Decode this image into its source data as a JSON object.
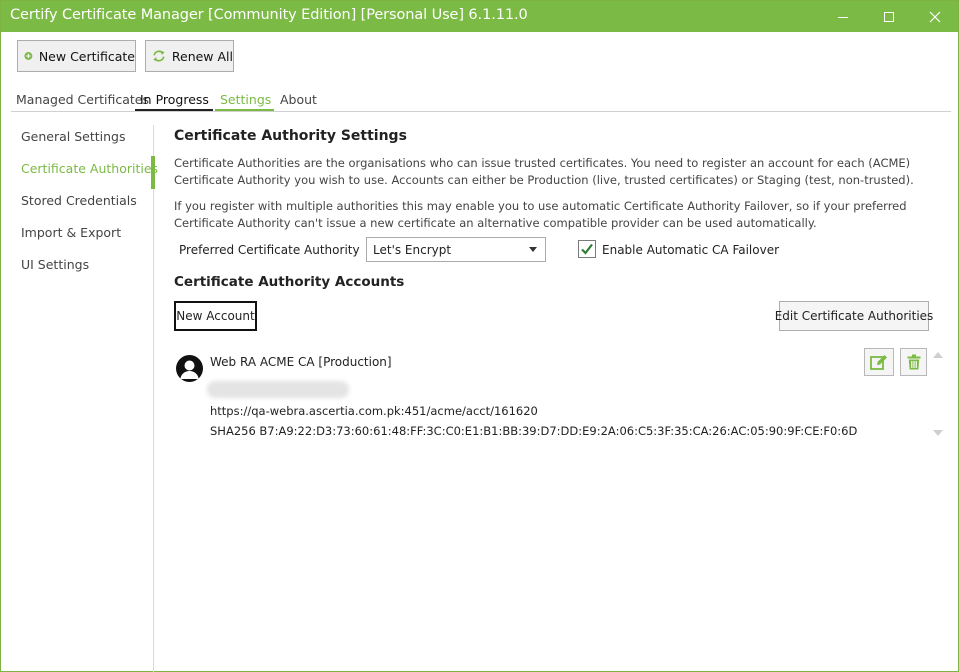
{
  "window": {
    "title": "Certify Certificate Manager [Community Edition] [Personal Use] 6.1.11.0"
  },
  "toolbar": {
    "new_certificate": "New Certificate",
    "renew_all": "Renew All"
  },
  "tabs": [
    "Managed Certificates",
    "In Progress",
    "Settings",
    "About"
  ],
  "sidebar": {
    "items": [
      "General Settings",
      "Certificate Authorities",
      "Stored Credentials",
      "Import & Export",
      "UI Settings"
    ],
    "selected": "Certificate Authorities"
  },
  "main": {
    "title": "Certificate Authority Settings",
    "description_1": "Certificate Authorities are the organisations who can issue trusted certificates. You need to register an account for each (ACME) Certificate Authority you wish to use. Accounts can either be Production (live, trusted certificates) or Staging (test, non-trusted).",
    "description_2": "If you register with multiple authorities this may enable you to use automatic Certificate Authority Failover, so if your preferred Certificate Authority can't issue a new certificate an alternative compatible provider can be used automatically.",
    "preferred_ca_label": "Preferred Certificate Authority",
    "preferred_ca_value": "Let's Encrypt",
    "failover_label": "Enable Automatic CA Failover",
    "failover_checked": true,
    "accounts_title": "Certificate Authority Accounts",
    "new_account": "New Account",
    "edit_cas": "Edit Certificate Authorities"
  },
  "account": {
    "name": "Web RA ACME CA [Production]",
    "url": "https://qa-webra.ascertia.com.pk:451/acme/acct/161620",
    "fingerprint": "SHA256 B7:A9:22:D3:73:60:61:48:FF:3C:C0:E1:B1:BB:39:D7:DD:E9:2A:06:C5:3F:35:CA:26:AC:05:90:9F:CE:F0:6D"
  },
  "colors": {
    "accent": "#7bba44",
    "titlebar": "#7bba44",
    "selected_text": "#7bba44"
  },
  "icons": {
    "new_certificate": "plus-circle-icon",
    "renew_all": "refresh-icon",
    "edit": "edit-icon",
    "delete": "trash-icon",
    "avatar": "user-avatar-icon"
  }
}
